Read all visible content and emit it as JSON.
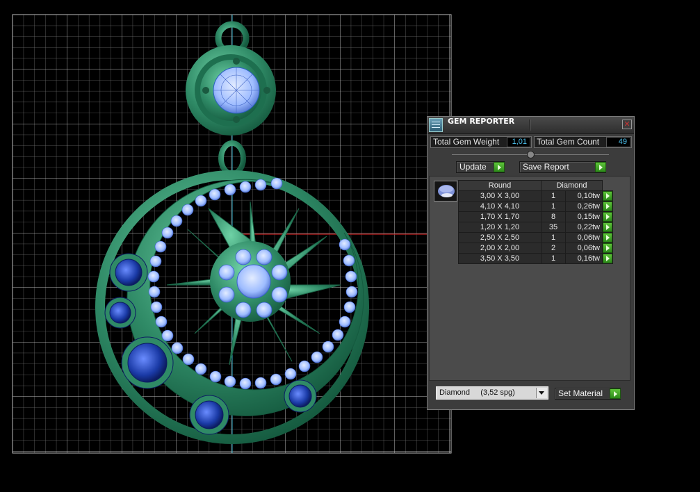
{
  "panel": {
    "title": "GEM REPORTER",
    "close_symbol": "✕",
    "total_gem_weight_label": "Total Gem Weight",
    "total_gem_weight_value": "1,01",
    "total_gem_count_label": "Total Gem Count",
    "total_gem_count_value": "49",
    "update_label": "Update",
    "save_report_label": "Save Report",
    "table_headers": [
      "Round",
      "Diamond"
    ],
    "rows": [
      {
        "size": "3,00 X 3,00",
        "count": "1",
        "weight": "0,10tw"
      },
      {
        "size": "4,10 X 4,10",
        "count": "1",
        "weight": "0,26tw"
      },
      {
        "size": "1,70 X 1,70",
        "count": "8",
        "weight": "0,15tw"
      },
      {
        "size": "1,20 X 1,20",
        "count": "35",
        "weight": "0,22tw"
      },
      {
        "size": "2,50 X 2,50",
        "count": "1",
        "weight": "0,06tw"
      },
      {
        "size": "2,00 X 2,00",
        "count": "2",
        "weight": "0,06tw"
      },
      {
        "size": "3,50 X 3,50",
        "count": "1",
        "weight": "0,16tw"
      }
    ],
    "material_select_value": "Diamond     (3,52 spg)",
    "set_material_label": "Set Material",
    "icons": {
      "app": "gem-reporter-app-icon",
      "gem_shape": "round-gem-icon"
    }
  },
  "colors": {
    "metal": "#2f8a66",
    "metal_light": "#5fbf96",
    "diamond": "#9ebcff",
    "sapphire": "#1a3aa6",
    "grid": "#9a9a9a",
    "go_button": "#3fa52a"
  }
}
